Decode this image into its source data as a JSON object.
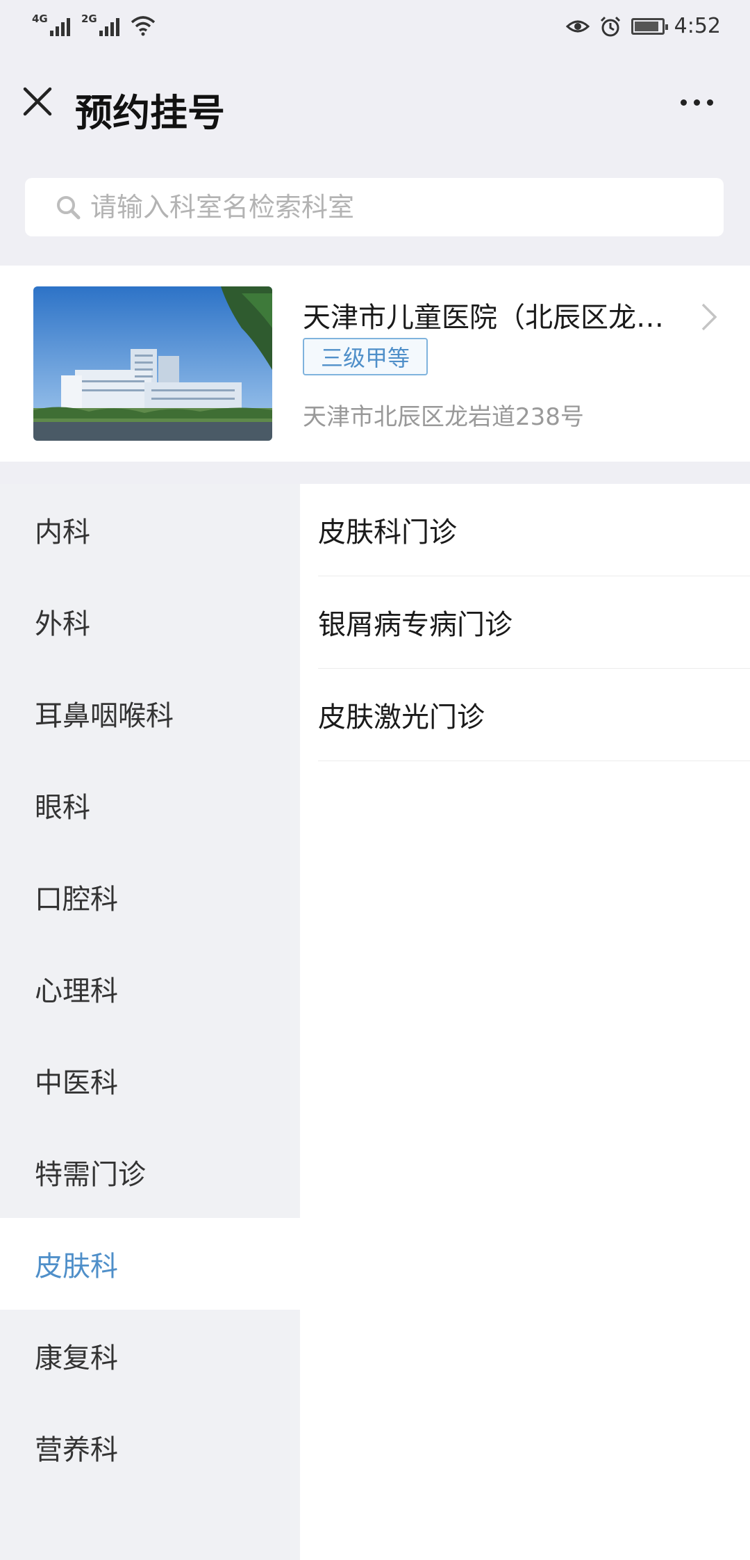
{
  "status_bar": {
    "signal1_label": "4G",
    "signal2_label": "2G",
    "time": "4:52"
  },
  "header": {
    "title": "预约挂号"
  },
  "search": {
    "placeholder": "请输入科室名检索科室"
  },
  "hospital": {
    "name": "天津市儿童医院（北辰区龙…",
    "level": "三级甲等",
    "address": "天津市北辰区龙岩道238号"
  },
  "sidebar": {
    "items": [
      {
        "label": "内科"
      },
      {
        "label": "外科"
      },
      {
        "label": "耳鼻咽喉科"
      },
      {
        "label": "眼科"
      },
      {
        "label": "口腔科"
      },
      {
        "label": "心理科"
      },
      {
        "label": "中医科"
      },
      {
        "label": "特需门诊"
      },
      {
        "label": "皮肤科"
      },
      {
        "label": "康复科"
      },
      {
        "label": "营养科"
      }
    ],
    "active_index": 8
  },
  "departments": {
    "items": [
      {
        "label": "皮肤科门诊"
      },
      {
        "label": "银屑病专病门诊"
      },
      {
        "label": "皮肤激光门诊"
      }
    ]
  },
  "colors": {
    "accent": "#4f8fc9",
    "background": "#efeff4"
  }
}
